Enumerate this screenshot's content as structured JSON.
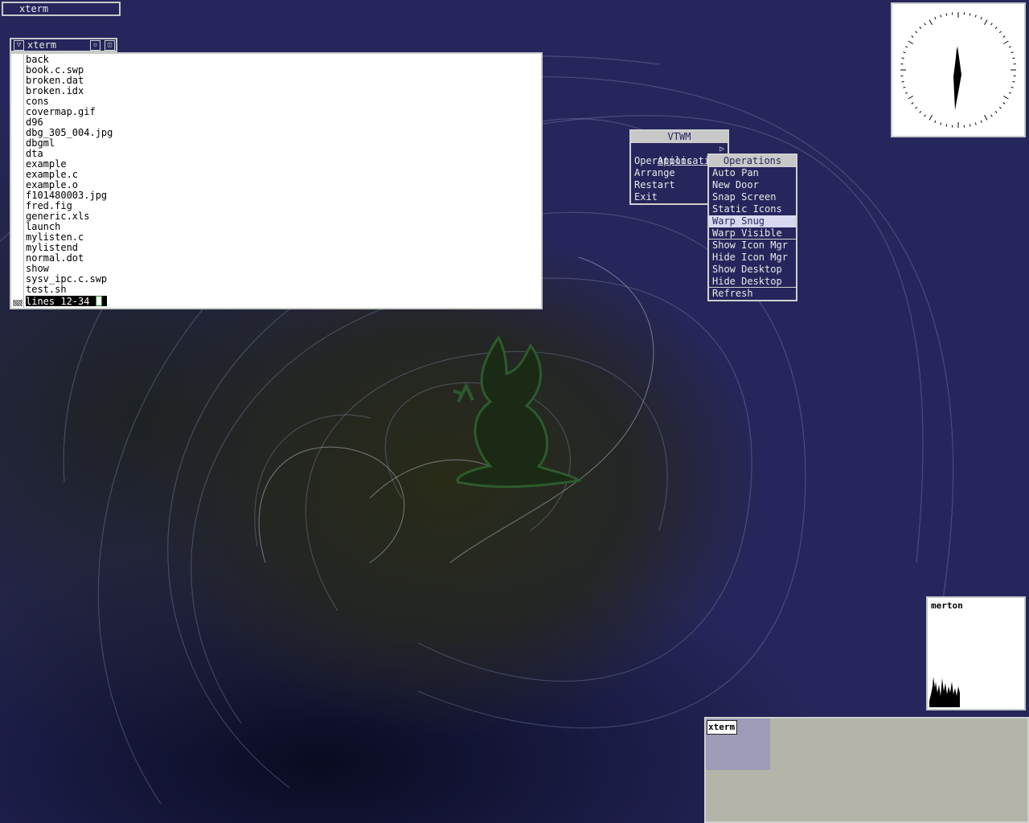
{
  "icon_manager": {
    "label": "xterm"
  },
  "xterm": {
    "title": "xterm",
    "files": [
      "back",
      "book.c.swp",
      "broken.dat",
      "broken.idx",
      "cons",
      "covermap.gif",
      "d96",
      "dbg_305_004.jpg",
      "dbgml",
      "dta",
      "example",
      "example.c",
      "example.o",
      "f101480003.jpg",
      "fred.fig",
      "generic.xls",
      "launch",
      "mylisten.c",
      "mylistend",
      "normal.dot",
      "show",
      "sysv_ipc.c.swp",
      "test.sh"
    ],
    "status": "lines 12-34"
  },
  "vtwm_menu": {
    "title": "VTWM",
    "items": [
      "Applications",
      "Operations",
      "Arrange",
      "Restart",
      "Exit"
    ],
    "submenu_arrow": "▷"
  },
  "operations_menu": {
    "title": "Operations",
    "items": [
      "Auto Pan",
      "New Door",
      "Snap Screen",
      "Static Icons",
      "Warp Snug",
      "Warp Visible",
      "Show Icon Mgr",
      "Hide Icon Mgr",
      "Show Desktop",
      "Hide Desktop",
      "Refresh"
    ],
    "active": "Warp Snug"
  },
  "load_monitor": {
    "host": "merton"
  },
  "panner": {
    "window_label": "xterm"
  },
  "colors": {
    "desktop": "#26265c",
    "menu_bg": "#26265c",
    "menu_border": "#d0d0d0",
    "panner_bg": "#b4b4a8"
  }
}
